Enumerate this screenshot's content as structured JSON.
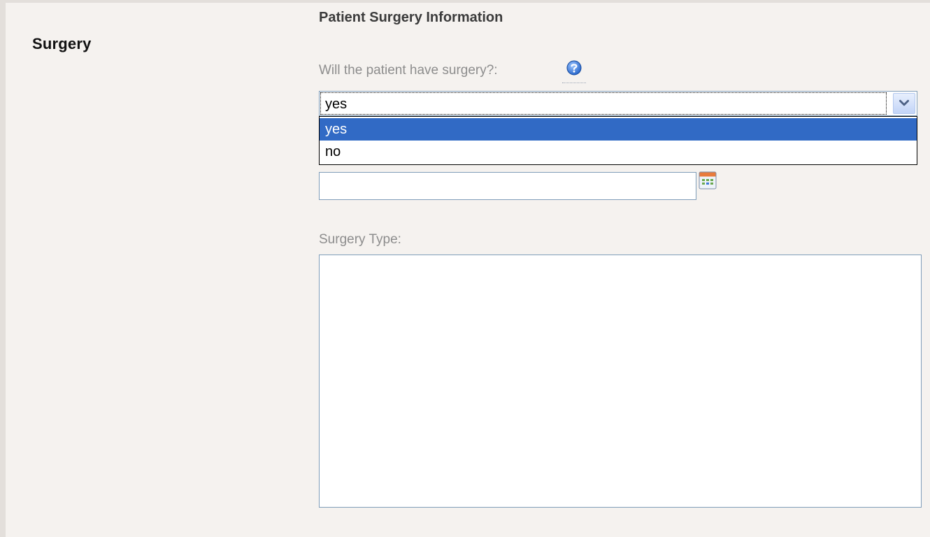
{
  "section": {
    "title": "Surgery"
  },
  "form": {
    "heading": "Patient Surgery Information",
    "surgery_question": {
      "label": "Will the patient have surgery?:",
      "help_icon": "question-help-icon",
      "selected_value": "yes",
      "options": [
        "yes",
        "no"
      ],
      "highlighted_option": "yes"
    },
    "surgery_date": {
      "value": "",
      "calendar_icon": "calendar-icon"
    },
    "surgery_type": {
      "label": "Surgery Type:",
      "value": ""
    }
  },
  "colors": {
    "background": "#f5f2ef",
    "highlight": "#316ac5",
    "input_border": "#7f9db9",
    "label_gray": "#8d8d8d"
  }
}
